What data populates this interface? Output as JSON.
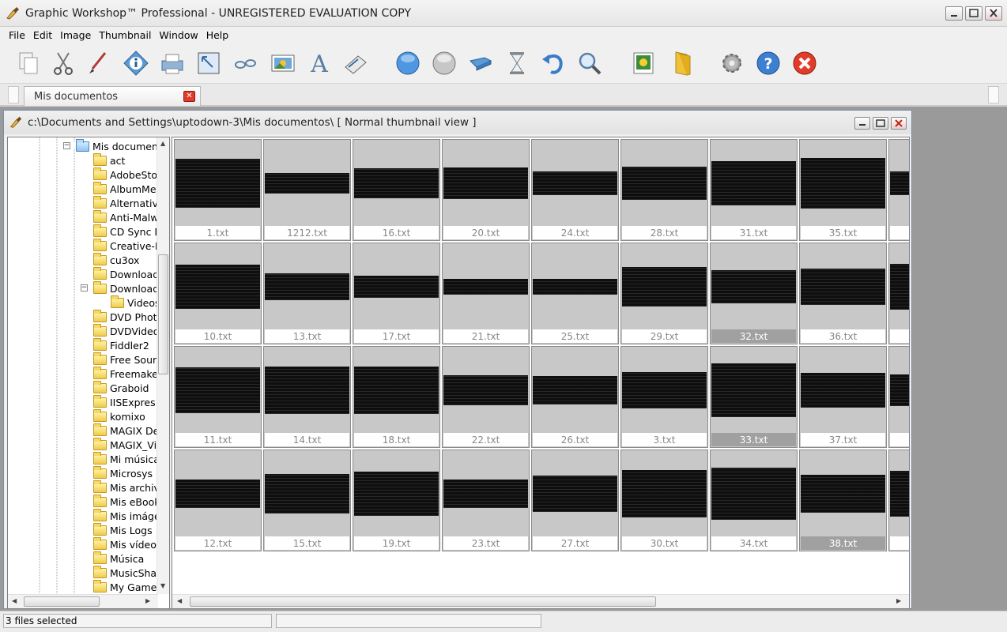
{
  "app": {
    "title": "Graphic Workshop™ Professional - UNREGISTERED EVALUATION COPY",
    "icon": "paint-brush-logo-icon"
  },
  "menu": [
    "File",
    "Edit",
    "Image",
    "Thumbnail",
    "Window",
    "Help"
  ],
  "toolbar": [
    {
      "name": "copy-icon"
    },
    {
      "name": "cut-icon"
    },
    {
      "name": "edit-brush-icon"
    },
    {
      "name": "info-icon"
    },
    {
      "name": "print-icon"
    },
    {
      "name": "resize-icon"
    },
    {
      "name": "glasses-view-icon"
    },
    {
      "name": "picture-icon"
    },
    {
      "name": "text-icon"
    },
    {
      "name": "scanner-icon"
    },
    {
      "name": "blue-circle-icon"
    },
    {
      "name": "gray-circle-icon"
    },
    {
      "name": "convert-icon"
    },
    {
      "name": "batch-hourglass-icon"
    },
    {
      "name": "undo-icon"
    },
    {
      "name": "zoom-icon"
    },
    {
      "name": "slideshow-icon"
    },
    {
      "name": "folder-icon"
    },
    {
      "name": "settings-gear-icon"
    },
    {
      "name": "help-icon"
    },
    {
      "name": "exit-icon"
    }
  ],
  "tab": {
    "label": "Mis documentos"
  },
  "window": {
    "path": "c:\\Documents and Settings\\uptodown-3\\Mis documentos\\  [ Normal thumbnail view ]"
  },
  "tree": {
    "root": "Mis document",
    "items": [
      "act",
      "AdobeSto",
      "AlbumMe",
      "Alternativ",
      "Anti-Malw",
      "CD Sync D",
      "Creative-I",
      "cu3ox",
      "Download",
      "Download",
      "Videos",
      "DVD Phot",
      "DVDVideo",
      "Fiddler2",
      "Free Sour",
      "Freemake",
      "Graboid",
      "IISExpres",
      "komixo",
      "MAGIX De",
      "MAGIX_Vi",
      "Mi música",
      "Microsys",
      "Mis archiv",
      "Mis eBook",
      "Mis imáge",
      "Mis Logs",
      "Mis vídeos",
      "Música",
      "MusicShak",
      "My Games"
    ]
  },
  "thumbnails": [
    [
      "1.txt",
      "1212.txt",
      "16.txt",
      "20.txt",
      "24.txt",
      "28.txt",
      "31.txt",
      "35.txt"
    ],
    [
      "10.txt",
      "13.txt",
      "17.txt",
      "21.txt",
      "25.txt",
      "29.txt",
      "32.txt",
      "36.txt"
    ],
    [
      "11.txt",
      "14.txt",
      "18.txt",
      "22.txt",
      "26.txt",
      "3.txt",
      "33.txt",
      "37.txt"
    ],
    [
      "12.txt",
      "15.txt",
      "19.txt",
      "23.txt",
      "27.txt",
      "30.txt",
      "34.txt",
      "38.txt"
    ]
  ],
  "selected": [
    "32.txt",
    "33.txt",
    "38.txt"
  ],
  "status": {
    "text": "3 files selected"
  }
}
